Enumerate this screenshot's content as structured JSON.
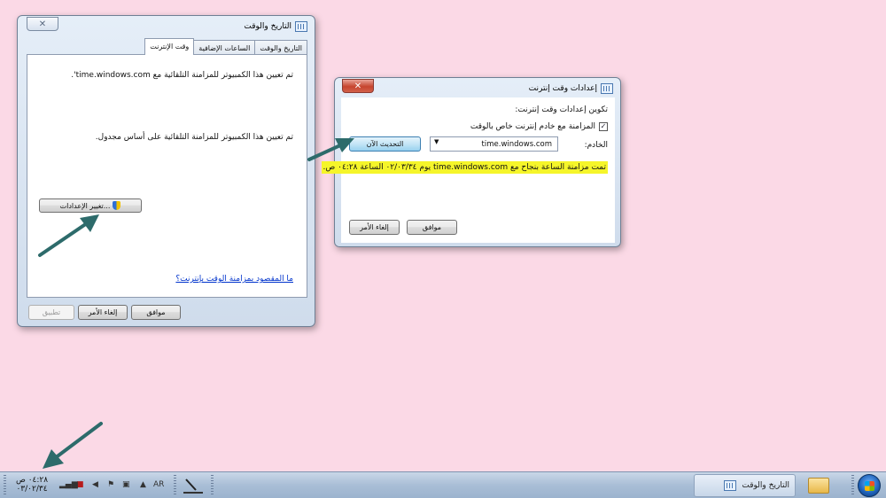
{
  "datetime_dialog": {
    "title": "التاريخ والوقت",
    "tabs": [
      "التاريخ والوقت",
      "الساعات الإضافية",
      "وقت الإنترنت"
    ],
    "line1": "تم تعيين هذا الكمبيوتر للمزامنة التلقائية مع time.windows.com'.",
    "line2": "تم تعيين هذا الكمبيوتر للمزامنة التلقائية على أساس مجدول.",
    "change_settings_button": "تغيير الإعدادات...",
    "help_link": "ما المقصود بمزامنة الوقت بإنترنت؟",
    "ok_button": "موافق",
    "cancel_button": "إلغاء الأمر",
    "apply_button": "تطبيق"
  },
  "internet_time_dialog": {
    "title": "إعدادات وقت إنترنت",
    "heading": "تكوين إعدادات وقت إنترنت:",
    "sync_checkbox_label": "المزامنة مع خادم إنترنت خاص بالوقت",
    "sync_checked": true,
    "server_label": "الخادم:",
    "server_value": "time.windows.com",
    "update_now_button": "التحديث الآن",
    "success_message": "تمت مزامنة الساعة بنجاح مع time.windows.com يوم ٠٢/٠٣/٣٤ الساعة ٠٤:٢٨ ص.",
    "ok_button": "موافق",
    "cancel_button": "إلغاء الأمر"
  },
  "taskbar": {
    "active_task_label": "التاريخ والوقت",
    "clock_time": "٠٤:٢٨ ص",
    "clock_date": "٠٣/٠٢/٣٤",
    "language": "AR"
  },
  "colors": {
    "desktop": "#fbd9e6",
    "arrow": "#2d6b6b",
    "highlight": "#f5f52a"
  }
}
